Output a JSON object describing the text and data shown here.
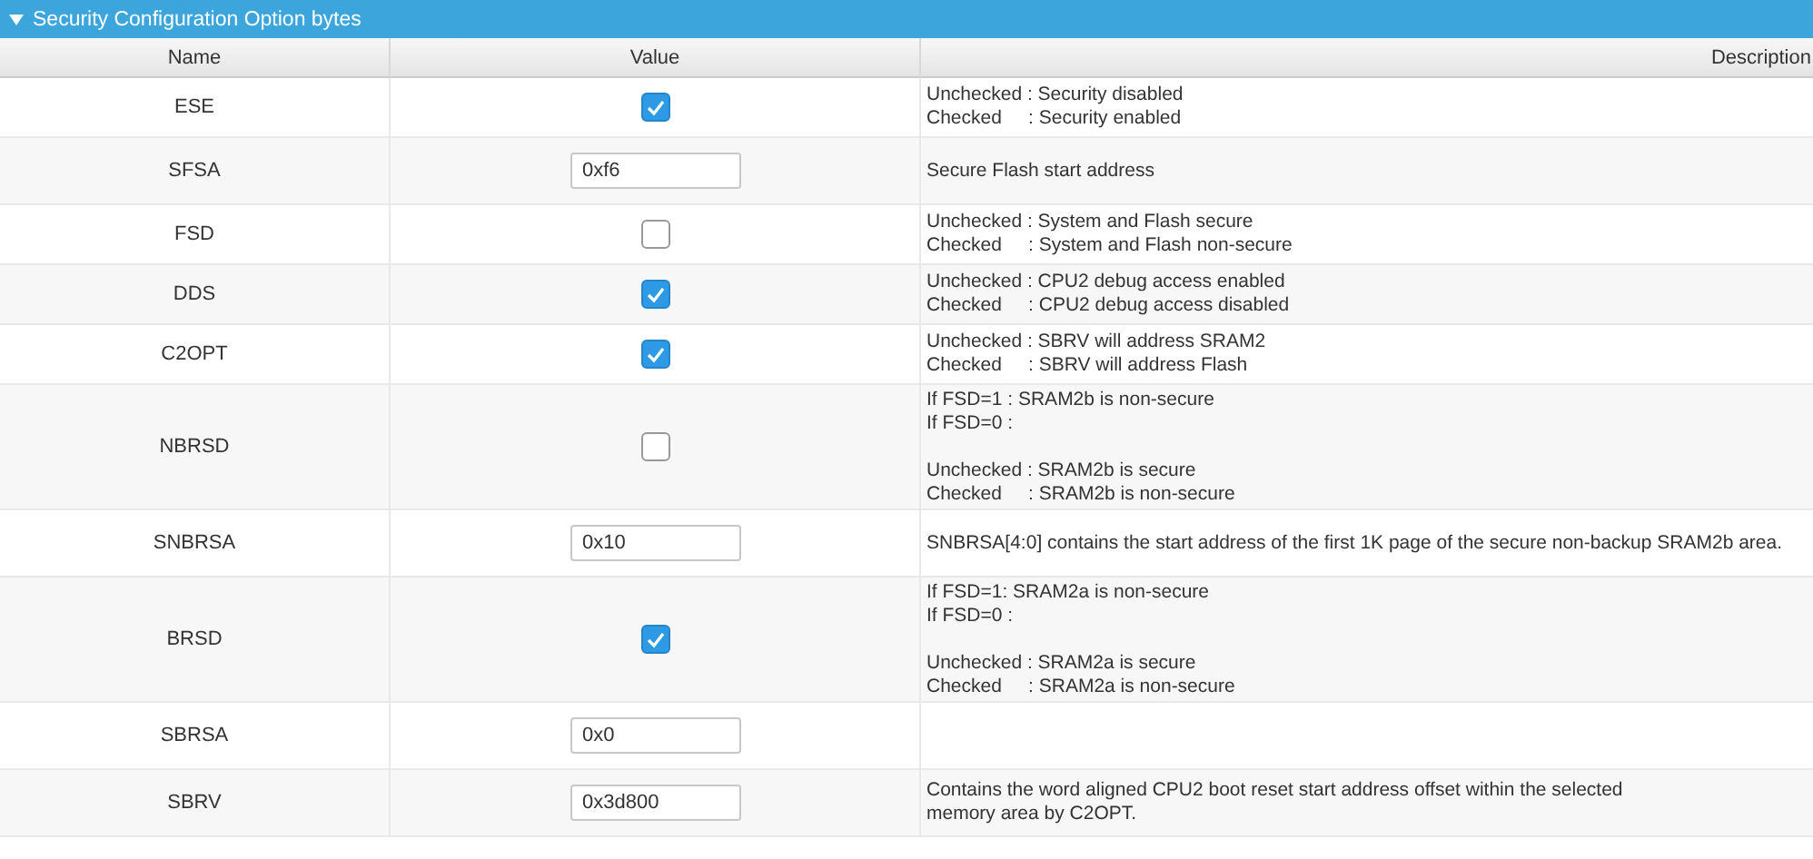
{
  "section": {
    "title": "Security Configuration Option bytes",
    "expanded": true
  },
  "table": {
    "columns": [
      "Name",
      "Value",
      "Description"
    ],
    "rows": [
      {
        "name": "ESE",
        "value": {
          "kind": "checkbox",
          "checked": true
        },
        "description": [
          {
            "text": "Unchecked : Security disabled"
          },
          {
            "text": "Checked     : Security enabled"
          }
        ]
      },
      {
        "name": "SFSA",
        "value": {
          "kind": "text",
          "value": "0xf6"
        },
        "description": [
          {
            "text": "Secure Flash start address"
          }
        ]
      },
      {
        "name": "FSD",
        "value": {
          "kind": "checkbox",
          "checked": false
        },
        "description": [
          {
            "text": "Unchecked : System and Flash secure"
          },
          {
            "text": "Checked     : System and Flash non-secure"
          }
        ]
      },
      {
        "name": "DDS",
        "value": {
          "kind": "checkbox",
          "checked": true
        },
        "description": [
          {
            "text": "Unchecked : CPU2 debug access enabled"
          },
          {
            "text": "Checked     : CPU2 debug access disabled"
          }
        ]
      },
      {
        "name": "C2OPT",
        "value": {
          "kind": "checkbox",
          "checked": true
        },
        "description": [
          {
            "text": "Unchecked : SBRV will address SRAM2"
          },
          {
            "text": "Checked     : SBRV will address Flash"
          }
        ]
      },
      {
        "name": "NBRSD",
        "value": {
          "kind": "checkbox",
          "checked": false
        },
        "description": [
          {
            "text": "If FSD=1 : SRAM2b is non-secure"
          },
          {
            "text": "If FSD=0 :"
          },
          {
            "text": "Unchecked : SRAM2b is secure",
            "gap_before": true
          },
          {
            "text": "Checked     : SRAM2b is non-secure"
          }
        ]
      },
      {
        "name": "SNBRSA",
        "value": {
          "kind": "text",
          "value": "0x10"
        },
        "description": [
          {
            "text": "SNBRSA[4:0] contains the start address of the first 1K page of the secure non-backup SRAM2b area."
          }
        ]
      },
      {
        "name": "BRSD",
        "value": {
          "kind": "checkbox",
          "checked": true
        },
        "description": [
          {
            "text": "If FSD=1: SRAM2a is non-secure"
          },
          {
            "text": "If FSD=0 :"
          },
          {
            "text": "Unchecked : SRAM2a is secure",
            "gap_before": true
          },
          {
            "text": "Checked     : SRAM2a is non-secure"
          }
        ]
      },
      {
        "name": "SBRSA",
        "value": {
          "kind": "text",
          "value": "0x0"
        },
        "description": []
      },
      {
        "name": "SBRV",
        "value": {
          "kind": "text",
          "value": "0x3d800"
        },
        "description": [
          {
            "text": "Contains the word aligned CPU2 boot reset start address offset within the selected"
          },
          {
            "text": "memory area by C2OPT."
          }
        ]
      }
    ]
  }
}
